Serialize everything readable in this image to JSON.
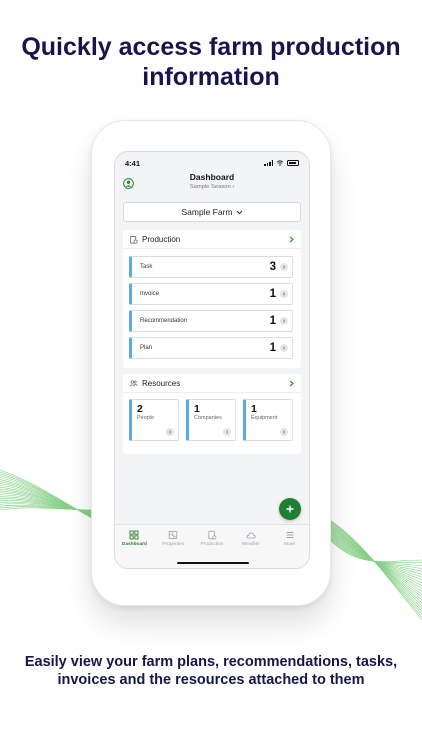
{
  "headline": "Quickly access farm production information",
  "caption": "Easily view your farm plans, recommendations, tasks, invoices and the resources attached to them",
  "status_bar": {
    "time": "4:41"
  },
  "header": {
    "title": "Dashboard",
    "subtitle": "Sample Season"
  },
  "farm_selector": {
    "value": "Sample Farm"
  },
  "production": {
    "title": "Production",
    "rows": [
      {
        "label": "Task",
        "count": "3"
      },
      {
        "label": "Invoice",
        "count": "1"
      },
      {
        "label": "Recommendation",
        "count": "1"
      },
      {
        "label": "Plan",
        "count": "1"
      }
    ]
  },
  "resources": {
    "title": "Resources",
    "tiles": [
      {
        "label": "People",
        "count": "2"
      },
      {
        "label": "Companies",
        "count": "1"
      },
      {
        "label": "Equipment",
        "count": "1"
      }
    ]
  },
  "tabs": [
    {
      "label": "Dashboard",
      "icon": "grid-icon",
      "active": true
    },
    {
      "label": "Properties",
      "icon": "map-icon",
      "active": false
    },
    {
      "label": "Production",
      "icon": "clipboard-icon",
      "active": false
    },
    {
      "label": "Weather",
      "icon": "cloud-sun-icon",
      "active": false
    },
    {
      "label": "More",
      "icon": "menu-icon",
      "active": false
    }
  ],
  "colors": {
    "navy": "#16164a",
    "accent_green": "#1e7e34",
    "row_accent": "#58aede",
    "wave_green": "#4caf50"
  }
}
